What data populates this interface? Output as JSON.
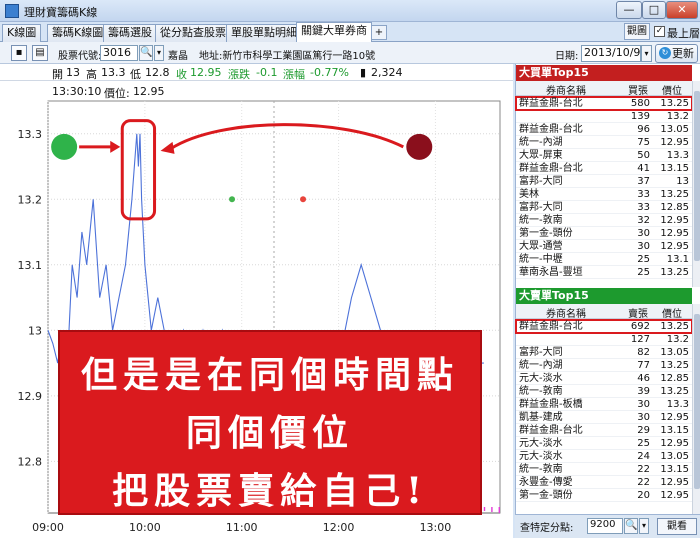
{
  "window": {
    "title": "理財寶籌碼K線",
    "min": "—",
    "max": "□",
    "close": "✕"
  },
  "tabs": [
    "K線圖",
    "籌碼K線圖",
    "籌碼選股",
    "從分點查股票",
    "單股單點明細",
    "關鍵大單券商"
  ],
  "active_tab": 5,
  "tab_add": "+",
  "view_button": "觀圖",
  "ontop": {
    "label": "最上層",
    "checked": "✓"
  },
  "toolbar": {
    "code_label": "股票代號:",
    "code_value": "3016",
    "search_glyph": "🔍",
    "dropdown_glyph": "▾",
    "company_name": "嘉晶",
    "company_addr": "地址:新竹市科學工業園區篤行一路10號",
    "date_label": "日期:",
    "date_value": "2013/10/9",
    "refresh_label": "更新",
    "refresh_glyph": "↻"
  },
  "quote": {
    "open_label": "開",
    "open": "13",
    "high_label": "高",
    "high": "13.3",
    "low_label": "低",
    "low": "12.8",
    "close_label": "收",
    "close": "12.95",
    "chg_label": "漲跌",
    "chg": "-0.1",
    "pct_label": "漲幅",
    "pct": "-0.77%",
    "vol": "2,324"
  },
  "chart_readout": {
    "time": "13:30:10",
    "price_label": "價位:",
    "price": "12.95"
  },
  "chart_data": {
    "type": "line",
    "x_ticks": [
      "09:00",
      "10:00",
      "11:00",
      "12:00",
      "13:00"
    ],
    "y_ticks": [
      "13.3",
      "13.2",
      "13.1",
      "13",
      "12.9",
      "12.8"
    ],
    "ylim": [
      12.77,
      13.35
    ],
    "series": [
      {
        "color": "#4d72d9",
        "points": [
          [
            "09:00",
            13.0
          ],
          [
            "09:03",
            12.98
          ],
          [
            "09:06",
            12.95
          ],
          [
            "09:09",
            13.0
          ],
          [
            "09:12",
            12.95
          ],
          [
            "09:15",
            13.1
          ],
          [
            "09:18",
            13.05
          ],
          [
            "09:21",
            13.15
          ],
          [
            "09:24",
            13.1
          ],
          [
            "09:28",
            13.2
          ],
          [
            "09:32",
            13.05
          ],
          [
            "09:36",
            13.1
          ],
          [
            "09:40",
            13.0
          ],
          [
            "09:44",
            13.05
          ],
          [
            "09:48",
            13.1
          ],
          [
            "09:52",
            13.2
          ],
          [
            "09:55",
            13.3
          ],
          [
            "09:56",
            13.25
          ],
          [
            "09:57",
            13.3
          ],
          [
            "09:58",
            13.2
          ],
          [
            "10:00",
            13.1
          ],
          [
            "10:04",
            13.0
          ],
          [
            "10:08",
            13.05
          ],
          [
            "10:12",
            13.0
          ],
          [
            "10:18",
            12.95
          ],
          [
            "10:24",
            13.0
          ],
          [
            "10:30",
            12.95
          ],
          [
            "10:36",
            13.0
          ],
          [
            "10:42",
            12.95
          ],
          [
            "10:48",
            13.0
          ],
          [
            "10:54",
            12.95
          ],
          [
            "11:00",
            12.95
          ],
          [
            "11:10",
            12.95
          ],
          [
            "11:20",
            12.9
          ],
          [
            "11:30",
            12.95
          ],
          [
            "11:40",
            12.9
          ],
          [
            "11:50",
            12.95
          ],
          [
            "12:00",
            12.95
          ],
          [
            "12:08",
            13.05
          ],
          [
            "12:14",
            13.1
          ],
          [
            "12:20",
            13.05
          ],
          [
            "12:26",
            13.0
          ],
          [
            "12:34",
            12.95
          ],
          [
            "12:42",
            12.95
          ],
          [
            "12:50",
            12.9
          ],
          [
            "12:58",
            12.95
          ],
          [
            "13:06",
            12.95
          ],
          [
            "13:14",
            12.9
          ],
          [
            "13:22",
            12.95
          ],
          [
            "13:30",
            12.95
          ]
        ]
      }
    ],
    "markers": [
      {
        "t": "09:10",
        "p": 13.28,
        "color": "#2fb34a",
        "r": 13
      },
      {
        "t": "12:50",
        "p": 13.28,
        "color": "#8a0f1c",
        "r": 13
      },
      {
        "t": "10:54",
        "p": 13.2,
        "color": "#43b54f",
        "r": 3
      },
      {
        "t": "11:38",
        "p": 13.2,
        "color": "#e8443c",
        "r": 3
      }
    ],
    "highlight": {
      "t0": "09:46",
      "t1": "10:06",
      "p0": 13.17,
      "p1": 13.32
    }
  },
  "annotation": {
    "line1": "但是是在同個時間點",
    "line2": "同個價位",
    "line3": "把股票賣給自己!"
  },
  "buy_panel": {
    "title": "大買單Top15",
    "headers": [
      "券商名稱",
      "買張",
      "價位"
    ],
    "rows": [
      [
        "群益金鼎-台北",
        "580",
        "13.25"
      ],
      [
        "",
        "139",
        "13.2"
      ],
      [
        "群益金鼎-台北",
        "96",
        "13.05"
      ],
      [
        "統一-內湖",
        "75",
        "12.95"
      ],
      [
        "大眾-屏東",
        "50",
        "13.3"
      ],
      [
        "群益金鼎-台北",
        "41",
        "13.15"
      ],
      [
        "富邦-大同",
        "37",
        "13"
      ],
      [
        "美林",
        "33",
        "13.25"
      ],
      [
        "富邦-大同",
        "33",
        "12.85"
      ],
      [
        "統一-敦南",
        "32",
        "12.95"
      ],
      [
        "第一金-頭份",
        "30",
        "12.95"
      ],
      [
        "大眾-通營",
        "30",
        "12.95"
      ],
      [
        "統一-中壢",
        "25",
        "13.1"
      ],
      [
        "華南永昌-豐垣",
        "25",
        "13.25"
      ]
    ]
  },
  "sell_panel": {
    "title": "大賣單Top15",
    "headers": [
      "券商名稱",
      "賣張",
      "價位"
    ],
    "rows": [
      [
        "群益金鼎-台北",
        "692",
        "13.25"
      ],
      [
        "",
        "127",
        "13.2"
      ],
      [
        "富邦-大同",
        "82",
        "13.05"
      ],
      [
        "統一-內湖",
        "77",
        "13.25"
      ],
      [
        "元大-淡水",
        "46",
        "12.85"
      ],
      [
        "統一-敦南",
        "39",
        "13.25"
      ],
      [
        "群益金鼎-板橋",
        "30",
        "13.3"
      ],
      [
        "凱基-建成",
        "30",
        "12.95"
      ],
      [
        "群益金鼎-台北",
        "29",
        "13.15"
      ],
      [
        "元大-淡水",
        "25",
        "12.95"
      ],
      [
        "元大-淡水",
        "24",
        "13.05"
      ],
      [
        "統一-敦南",
        "22",
        "13.15"
      ],
      [
        "永豐金-傳愛",
        "22",
        "12.95"
      ],
      [
        "第一金-頭份",
        "20",
        "12.95"
      ]
    ]
  },
  "query": {
    "label": "查特定分點:",
    "value": "9200",
    "search_glyph": "🔍",
    "dropdown_glyph": "▾",
    "button": "觀看"
  },
  "colors": {
    "up": "#c31f1f",
    "down": "#1d9a2e",
    "accent": "#da1a1e"
  }
}
